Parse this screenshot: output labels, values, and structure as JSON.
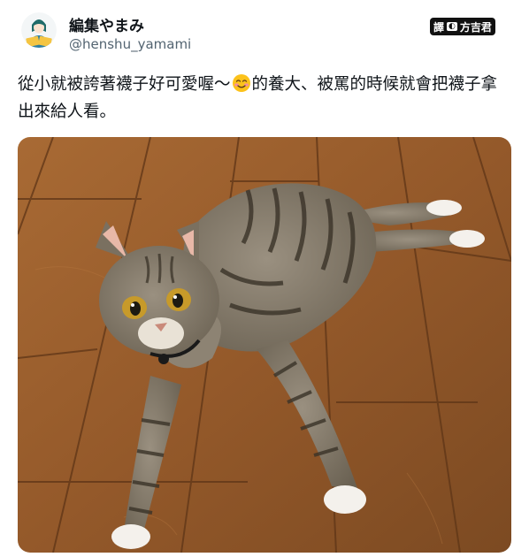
{
  "author": {
    "display_name": "編集やまみ",
    "handle": "@henshu_yamami"
  },
  "translator_badge": {
    "left": "譯",
    "right": "方吉君"
  },
  "tweet": {
    "text_before_emoji": "從小就被誇著襪子好可愛喔～",
    "emoji": "smiling-face-with-smiling-eyes",
    "text_after_emoji": "的養大、被罵的時候就會把襪子拿出來給人看。"
  },
  "photo": {
    "subject": "tabby-cat-with-white-paws",
    "colors": {
      "floor": "#9a5e2c",
      "fur": "#7d7466",
      "stripes": "#3a3328"
    }
  }
}
